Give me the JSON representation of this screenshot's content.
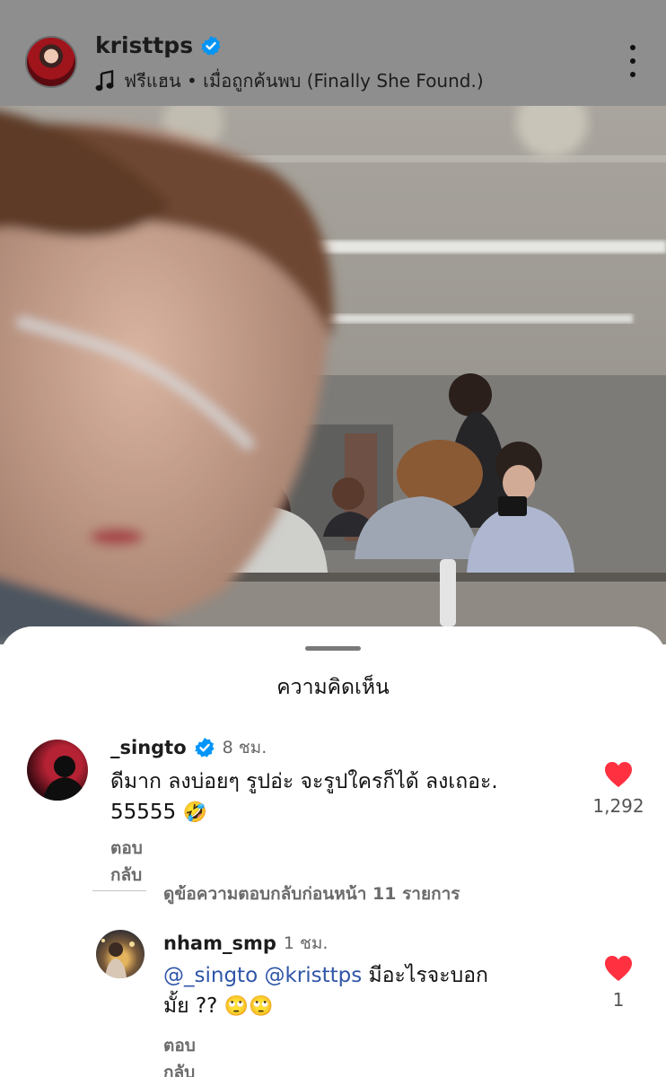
{
  "post": {
    "username": "kristtps",
    "music": "ฟรีแฮน • เมื่อถูกค้นพบ (Finally She Found.)",
    "icons": {
      "verified": "verified-badge-icon",
      "music": "music-note-icon",
      "more": "more-vertical-icon"
    }
  },
  "sheet": {
    "title": "ความคิดเห็น"
  },
  "comments": [
    {
      "username": "_singto",
      "time": "8 ชม.",
      "text_line1": "ดีมาก ลงบ่อยๆ รูปอ่ะ จะรูปใครก็ได้ ลงเถอะ.",
      "text_line2": "55555",
      "emoji": "🤣",
      "reply_label": "ตอบกลับ",
      "likes": "1,292"
    }
  ],
  "view_replies": "ดูข้อความตอบกลับก่อนหน้า 11 รายการ",
  "reply": {
    "username": "nham_smp",
    "time": "1 ชม.",
    "mention1": "@_singto",
    "mention2": "@kristtps",
    "text_after": "มีอะไรจะบอก",
    "text_line2": "มั้ย ??",
    "emoji": "🙄🙄",
    "reply_label": "ตอบกลับ",
    "likes": "1"
  },
  "colors": {
    "like": "#ff3040",
    "verified": "#0095f6",
    "mention": "#2f55a8"
  }
}
